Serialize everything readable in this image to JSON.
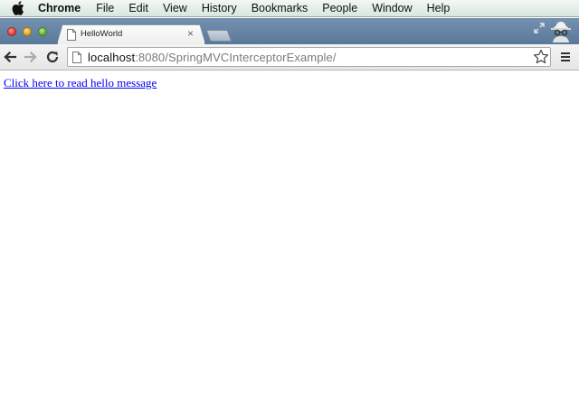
{
  "menubar": {
    "app_name": "Chrome",
    "items": [
      "File",
      "Edit",
      "View",
      "History",
      "Bookmarks",
      "People",
      "Window",
      "Help"
    ]
  },
  "tab": {
    "title": "HelloWorld",
    "close_glyph": "×"
  },
  "toolbar": {
    "url_host": "localhost",
    "url_rest": ":8080/SpringMVCInterceptorExample/"
  },
  "page": {
    "link_text": "Click here to read hello message"
  },
  "icons": {
    "back": "arrow-left-icon",
    "forward": "arrow-right-icon",
    "reload": "reload-icon",
    "star": "star-icon",
    "menu": "hamburger-menu-icon",
    "incognito": "incognito-icon",
    "fullscreen": "fullscreen-icon"
  },
  "colors": {
    "link": "#0000ee",
    "tabstrip": "#6a87a8"
  }
}
